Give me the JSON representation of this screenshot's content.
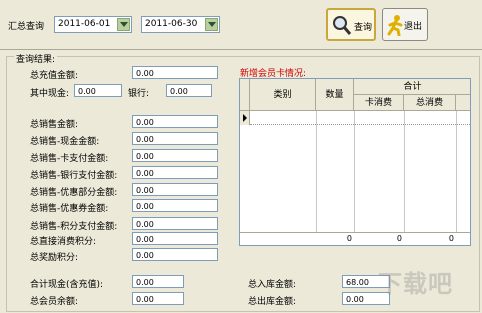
{
  "toolbar": {
    "summary_query_label": "汇总查询",
    "start_date": "2011-06-01",
    "end_date": "2011-06-30",
    "query_button": "查询",
    "exit_button": "退出"
  },
  "results": {
    "group_title": "查询结果:",
    "total_recharge_label": "总充值金额:",
    "total_recharge_value": "0.00",
    "of_which_cash_label": "其中现金:",
    "of_which_cash_value": "0.00",
    "bank_label": "银行:",
    "bank_value": "0.00",
    "sales": [
      {
        "label": "总销售金额:",
        "value": "0.00"
      },
      {
        "label": "总销售-现金金额:",
        "value": "0.00"
      },
      {
        "label": "总销售-卡支付金额:",
        "value": "0.00"
      },
      {
        "label": "总销售-银行支付金额:",
        "value": "0.00"
      },
      {
        "label": "总销售-优惠部分金额:",
        "value": "0.00"
      },
      {
        "label": "总销售-优惠券金额:",
        "value": "0.00"
      }
    ],
    "points": [
      {
        "label": "总销售-积分支付金额:",
        "value": "0.00"
      },
      {
        "label": "总直接消费积分:",
        "value": "0.00"
      },
      {
        "label": "总奖励积分:",
        "value": "0.00"
      }
    ],
    "cash_total_label": "合计现金(含充值):",
    "cash_total_value": "0.00",
    "member_balance_label": "总会员余额:",
    "member_balance_value": "0.00",
    "stock_in_label": "总入库金额:",
    "stock_in_value": "68.00",
    "stock_out_label": "总出库金额:",
    "stock_out_value": "0.00"
  },
  "new_cards": {
    "title": "新增会员卡情况:",
    "col_category": "类别",
    "col_count": "数量",
    "col_total": "合计",
    "col_card_spend": "卡消费",
    "col_total_spend": "总消费",
    "totals": [
      "0",
      "0",
      "0"
    ]
  },
  "accent_title_color": "#d00000",
  "watermark_text": "下载吧"
}
